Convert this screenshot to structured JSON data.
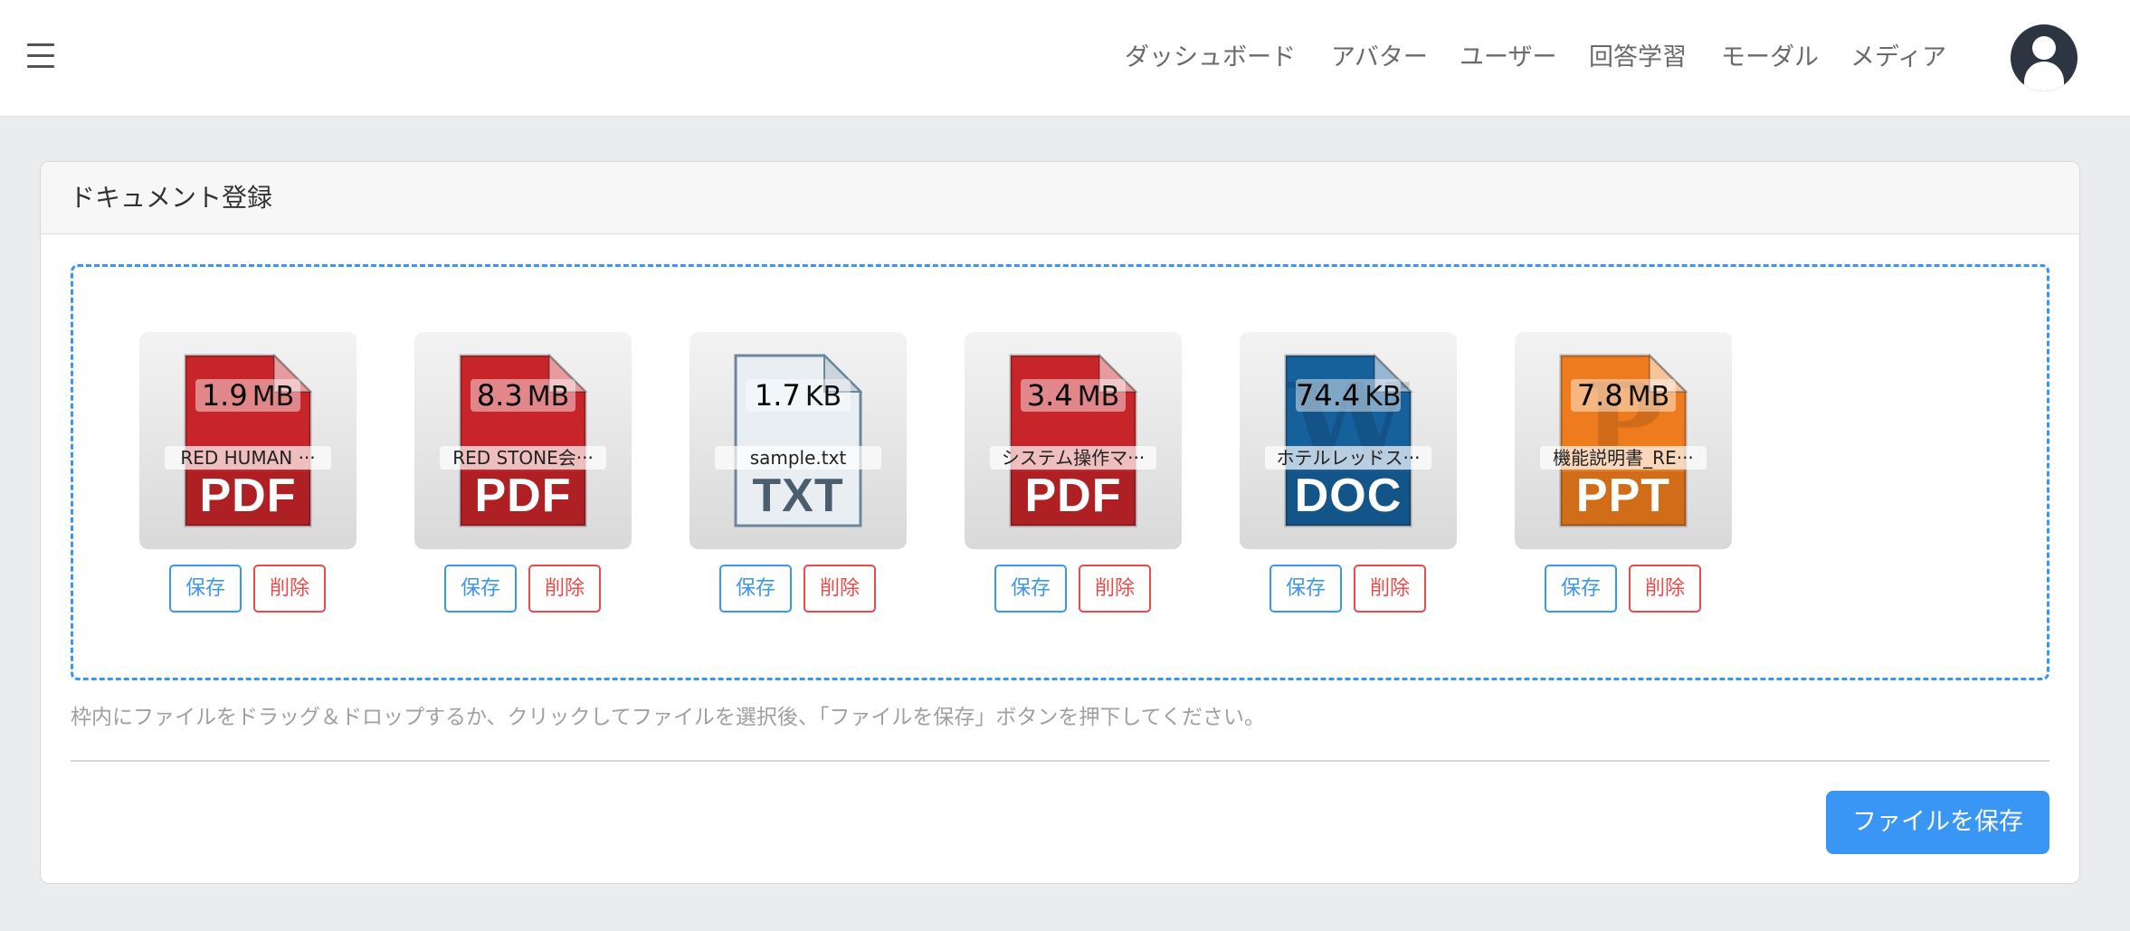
{
  "header": {
    "menu_icon": "hamburger-menu-icon",
    "nav": [
      {
        "label": "ダッシュボード"
      },
      {
        "label": "アバター"
      },
      {
        "label": "ユーザー"
      },
      {
        "label": "回答学習"
      },
      {
        "label": "モーダル"
      },
      {
        "label": "メディア"
      }
    ],
    "avatar_icon": "user-avatar-icon"
  },
  "card": {
    "title": "ドキュメント登録",
    "files": [
      {
        "size": "1.9",
        "unit": "MB",
        "name": "RED HUMAN ···",
        "type": "PDF",
        "color": "#c8252b",
        "glyph": "",
        "save_label": "保存",
        "delete_label": "削除"
      },
      {
        "size": "8.3",
        "unit": "MB",
        "name": "RED STONE会···",
        "type": "PDF",
        "color": "#c8252b",
        "glyph": "",
        "save_label": "保存",
        "delete_label": "削除"
      },
      {
        "size": "1.7",
        "unit": "KB",
        "name": "sample.txt",
        "type": "TXT",
        "color": "#e9eef2",
        "glyph": "",
        "save_label": "保存",
        "delete_label": "削除"
      },
      {
        "size": "3.4",
        "unit": "MB",
        "name": "システム操作マ···",
        "type": "PDF",
        "color": "#c8252b",
        "glyph": "",
        "save_label": "保存",
        "delete_label": "削除"
      },
      {
        "size": "74.4",
        "unit": "KB",
        "name": "ホテルレッドス···",
        "type": "DOC",
        "color": "#16609c",
        "glyph": "W",
        "save_label": "保存",
        "delete_label": "削除"
      },
      {
        "size": "7.8",
        "unit": "MB",
        "name": "機能説明書_RE···",
        "type": "PPT",
        "color": "#ee7b1d",
        "glyph": "P",
        "save_label": "保存",
        "delete_label": "削除"
      }
    ],
    "help_text": "枠内にファイルをドラッグ＆ドロップするか、クリックしてファイルを選択後、「ファイルを保存」ボタンを押下してください。",
    "submit_label": "ファイルを保存"
  },
  "colors": {
    "accent": "#3a96f5",
    "danger": "#e94b4b",
    "pdf": "#c8252b",
    "doc": "#16609c",
    "ppt": "#ee7b1d",
    "txt": "#e9eef2"
  }
}
